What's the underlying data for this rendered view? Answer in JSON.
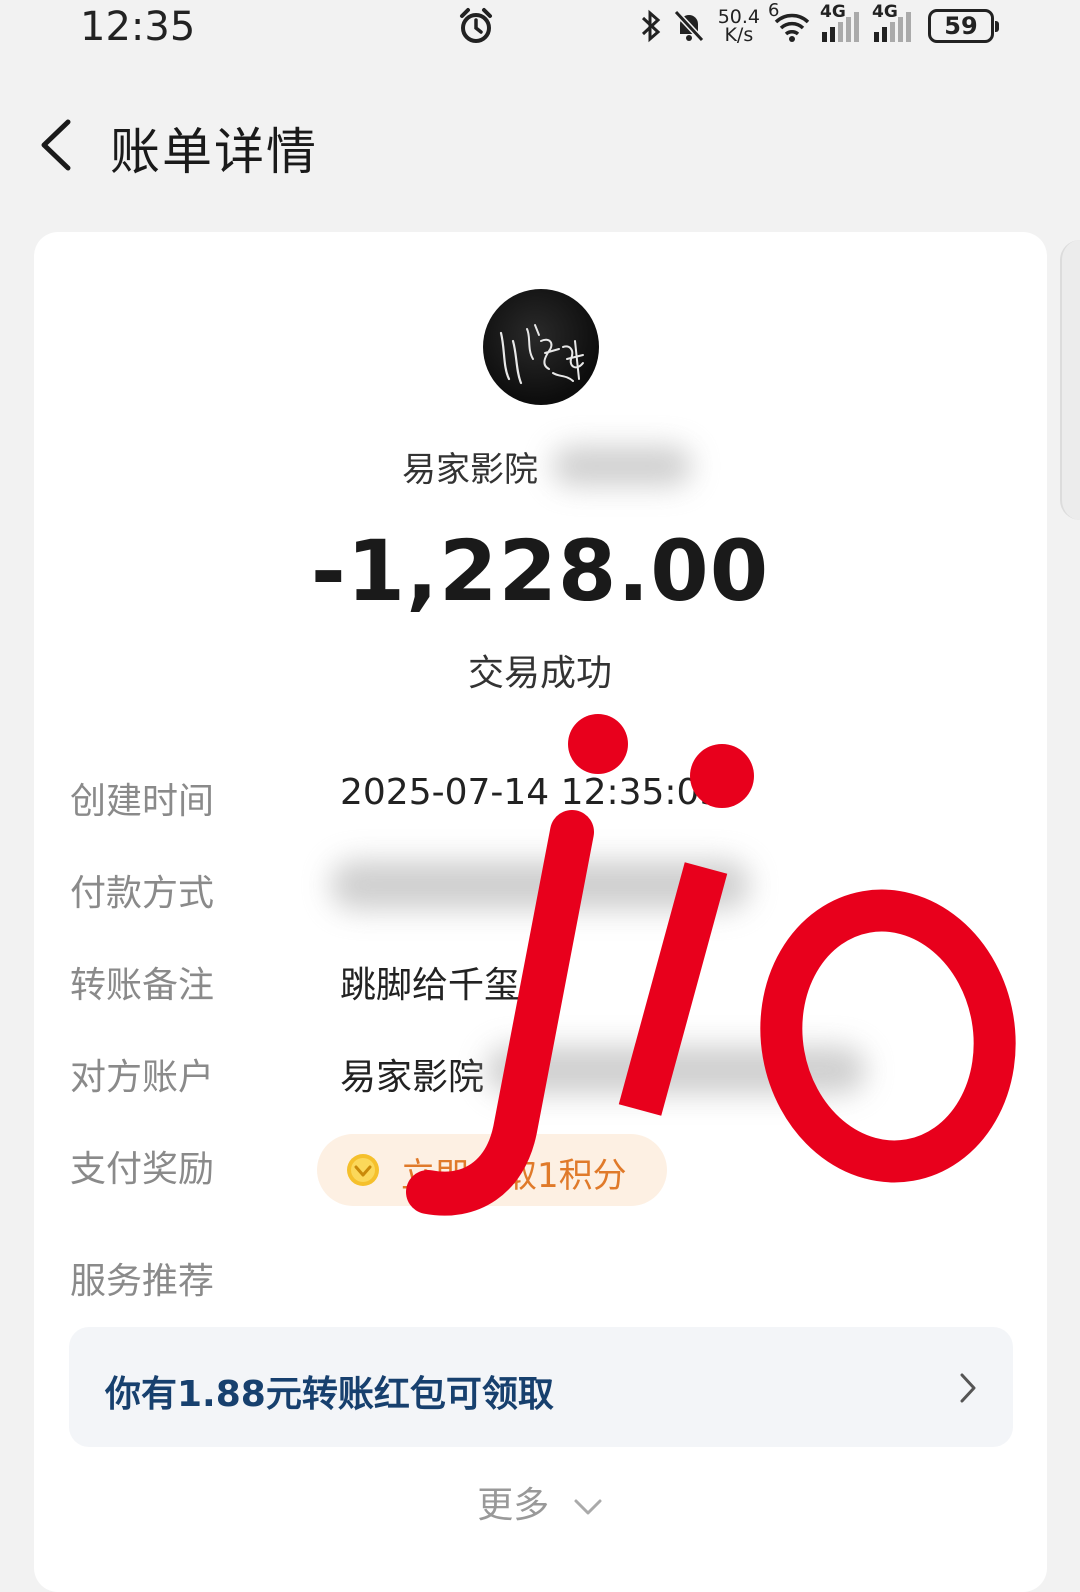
{
  "status_bar": {
    "time": "12:35",
    "net_speed_value": "50.4",
    "net_speed_unit": "K/s",
    "wifi_label": "6",
    "sim1_label": "4G",
    "sim2_label": "4G",
    "battery": "59"
  },
  "header": {
    "title": "账单详情"
  },
  "merchant": {
    "name": "易家影院"
  },
  "transaction": {
    "amount": "-1,228.00",
    "status": "交易成功"
  },
  "details": {
    "created_label": "创建时间",
    "created_value": "2025-07-14 12:35:05",
    "payment_label": "付款方式",
    "note_label": "转账备注",
    "note_value": "跳脚给千玺",
    "counterparty_label": "对方账户",
    "counterparty_value": "易家影院",
    "reward_label": "支付奖励",
    "reward_value": "立即领取1积分",
    "service_label": "服务推荐"
  },
  "promo": {
    "text": "你有1.88元转账红包可领取"
  },
  "more": {
    "label": "更多"
  },
  "colors": {
    "background": "#f2f2f2",
    "card": "#ffffff",
    "promo_text": "#17406e",
    "reward_text": "#e07a2a",
    "watermark": "#e8001c"
  }
}
